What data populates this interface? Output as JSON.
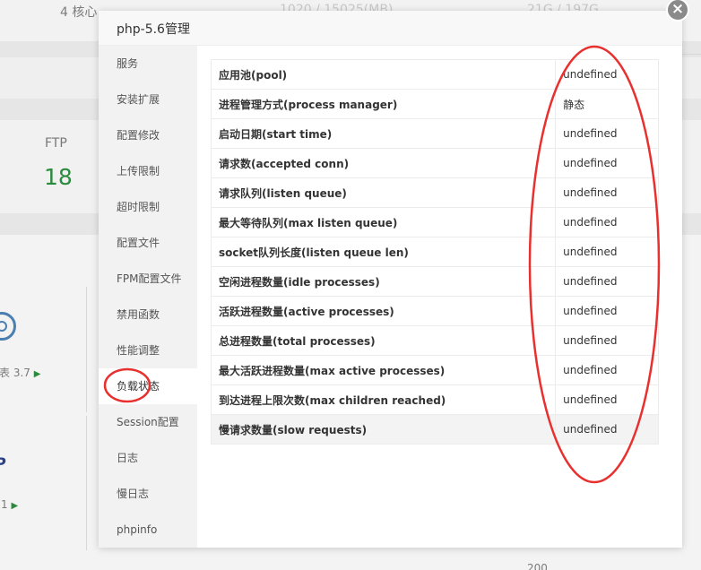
{
  "background": {
    "top_cpu": "4 核心",
    "top_memory": "1020 / 15025(MB)",
    "top_disk": "21G / 197G",
    "ftp_label": "FTP",
    "ftp_value": "18",
    "card_version": "表 3.7",
    "card_version2": "1",
    "php_logo": "P",
    "bottom_value": "200"
  },
  "modal": {
    "title": "php-5.6管理",
    "close_symbol": "×",
    "menu": [
      {
        "label": "服务"
      },
      {
        "label": "安装扩展"
      },
      {
        "label": "配置修改"
      },
      {
        "label": "上传限制"
      },
      {
        "label": "超时限制"
      },
      {
        "label": "配置文件"
      },
      {
        "label": "FPM配置文件"
      },
      {
        "label": "禁用函数"
      },
      {
        "label": "性能调整"
      },
      {
        "label": "负载状态",
        "active": true
      },
      {
        "label": "Session配置"
      },
      {
        "label": "日志"
      },
      {
        "label": "慢日志"
      },
      {
        "label": "phpinfo"
      }
    ],
    "status_rows": [
      {
        "key": "应用池(pool)",
        "value": "undefined"
      },
      {
        "key": "进程管理方式(process manager)",
        "value": "静态"
      },
      {
        "key": "启动日期(start time)",
        "value": "undefined"
      },
      {
        "key": "请求数(accepted conn)",
        "value": "undefined"
      },
      {
        "key": "请求队列(listen queue)",
        "value": "undefined"
      },
      {
        "key": "最大等待队列(max listen queue)",
        "value": "undefined"
      },
      {
        "key": "socket队列长度(listen queue len)",
        "value": "undefined"
      },
      {
        "key": "空闲进程数量(idle processes)",
        "value": "undefined"
      },
      {
        "key": "活跃进程数量(active processes)",
        "value": "undefined"
      },
      {
        "key": "总进程数量(total processes)",
        "value": "undefined"
      },
      {
        "key": "最大活跃进程数量(max active processes)",
        "value": "undefined"
      },
      {
        "key": "到达进程上限次数(max children reached)",
        "value": "undefined"
      },
      {
        "key": "慢请求数量(slow requests)",
        "value": "undefined"
      }
    ]
  },
  "colors": {
    "annotation": "#e8312f",
    "ftp_green": "#2b8a3e"
  }
}
